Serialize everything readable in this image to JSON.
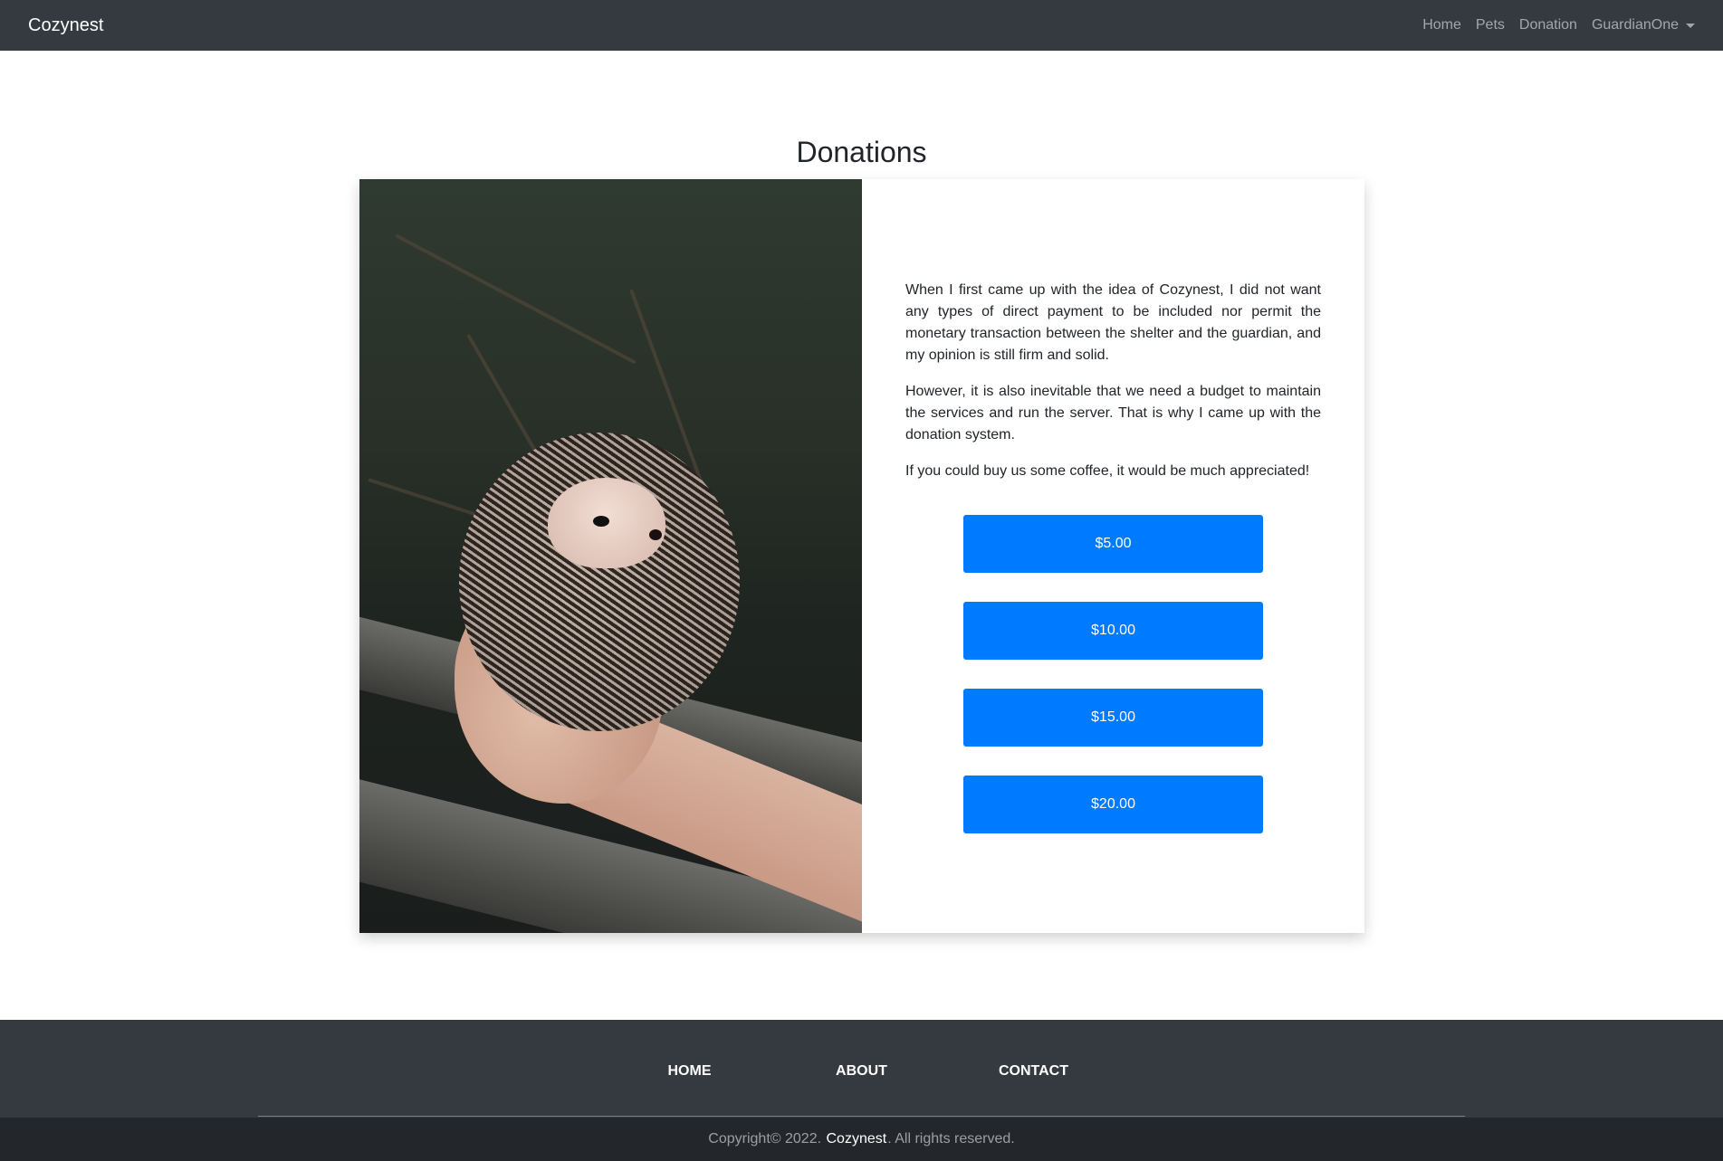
{
  "navbar": {
    "brand": "Cozynest",
    "links": [
      "Home",
      "Pets",
      "Donation"
    ],
    "user": "GuardianOne"
  },
  "main": {
    "title": "Donations",
    "image_alt": "hedgehog-photo",
    "paragraphs": [
      "When I first came up with the idea of Cozynest, I did not want any types of direct payment to be included nor permit the monetary transaction between the shelter and the guardian, and my opinion is still firm and solid.",
      "However, it is also inevitable that we need a budget to maintain the services and run the server. That is why I came up with the donation system.",
      "If you could buy us some coffee, it would be much appreciated!"
    ],
    "donation_options": [
      "$5.00",
      "$10.00",
      "$15.00",
      "$20.00"
    ]
  },
  "footer": {
    "links": [
      "HOME",
      "ABOUT",
      "CONTACT"
    ],
    "copyright_prefix": "Copyright© 2022.",
    "copyright_brand": "Cozynest",
    "copyright_suffix": ". All rights reserved."
  },
  "colors": {
    "navbar_bg": "#343a40",
    "accent": "#007bff",
    "copyright_bg": "#23272b"
  }
}
